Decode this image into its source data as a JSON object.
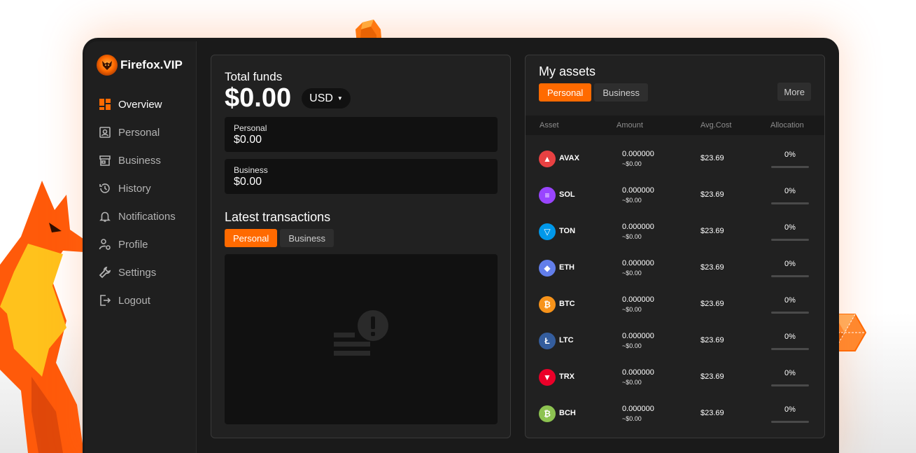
{
  "brand": {
    "name": "Firefox.VIP",
    "accent": "#ff6a00"
  },
  "sidebar": {
    "items": [
      {
        "label": "Overview",
        "icon": "dashboard-icon",
        "active": true
      },
      {
        "label": "Personal",
        "icon": "user-card-icon",
        "active": false
      },
      {
        "label": "Business",
        "icon": "store-icon",
        "active": false
      },
      {
        "label": "History",
        "icon": "history-icon",
        "active": false
      },
      {
        "label": "Notifications",
        "icon": "bell-icon",
        "active": false
      },
      {
        "label": "Profile",
        "icon": "profile-settings-icon",
        "active": false
      },
      {
        "label": "Settings",
        "icon": "wrench-icon",
        "active": false
      },
      {
        "label": "Logout",
        "icon": "logout-icon",
        "active": false
      }
    ]
  },
  "funds": {
    "title": "Total funds",
    "total": "$0.00",
    "currency": "USD",
    "personal": {
      "label": "Personal",
      "value": "$0.00"
    },
    "business": {
      "label": "Business",
      "value": "$0.00"
    }
  },
  "transactions": {
    "title": "Latest transactions",
    "tabs": [
      "Personal",
      "Business"
    ],
    "empty_icon": "empty-list-alert-icon"
  },
  "assets": {
    "title": "My assets",
    "tabs": [
      "Personal",
      "Business"
    ],
    "more": "More",
    "columns": [
      "Asset",
      "Amount",
      "Avg.Cost",
      "Allocation"
    ],
    "rows": [
      {
        "symbol": "AVAX",
        "amount": "0.000000",
        "amount_usd": "~$0.00",
        "avg_cost": "$23.69",
        "allocation": "0%",
        "allocation_value": 0,
        "color": "#e84142",
        "icon": "avax-icon"
      },
      {
        "symbol": "SOL",
        "amount": "0.000000",
        "amount_usd": "~$0.00",
        "avg_cost": "$23.69",
        "allocation": "0%",
        "allocation_value": 0,
        "color": "#9945ff",
        "icon": "sol-icon"
      },
      {
        "symbol": "TON",
        "amount": "0.000000",
        "amount_usd": "~$0.00",
        "avg_cost": "$23.69",
        "allocation": "0%",
        "allocation_value": 0,
        "color": "#0098ea",
        "icon": "ton-icon"
      },
      {
        "symbol": "ETH",
        "amount": "0.000000",
        "amount_usd": "~$0.00",
        "avg_cost": "$23.69",
        "allocation": "0%",
        "allocation_value": 0,
        "color": "#627eea",
        "icon": "eth-icon"
      },
      {
        "symbol": "BTC",
        "amount": "0.000000",
        "amount_usd": "~$0.00",
        "avg_cost": "$23.69",
        "allocation": "0%",
        "allocation_value": 0,
        "color": "#f7931a",
        "icon": "btc-icon"
      },
      {
        "symbol": "LTC",
        "amount": "0.000000",
        "amount_usd": "~$0.00",
        "avg_cost": "$23.69",
        "allocation": "0%",
        "allocation_value": 0,
        "color": "#345d9d",
        "icon": "ltc-icon"
      },
      {
        "symbol": "TRX",
        "amount": "0.000000",
        "amount_usd": "~$0.00",
        "avg_cost": "$23.69",
        "allocation": "0%",
        "allocation_value": 0,
        "color": "#eb0029",
        "icon": "trx-icon"
      },
      {
        "symbol": "BCH",
        "amount": "0.000000",
        "amount_usd": "~$0.00",
        "avg_cost": "$23.69",
        "allocation": "0%",
        "allocation_value": 0,
        "color": "#8dc351",
        "icon": "bch-icon"
      }
    ]
  }
}
